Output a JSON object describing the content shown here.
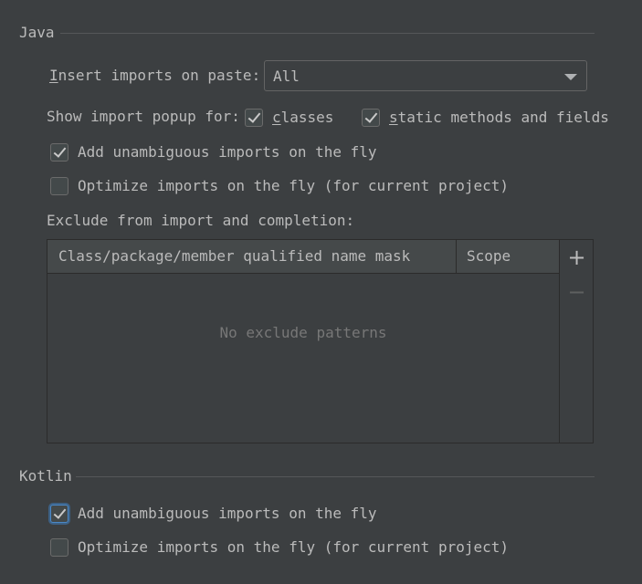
{
  "java": {
    "title": "Java",
    "insert_imports_label": "Insert imports on paste:",
    "insert_imports_mnemonic": "I",
    "insert_imports_rest": "nsert imports on paste:",
    "insert_imports_value": "All",
    "show_popup_label": "Show import popup for:",
    "classes": {
      "mnemonic": "c",
      "rest": "lasses",
      "checked": true
    },
    "static_methods": {
      "mnemonic": "s",
      "rest": "tatic methods and fields",
      "checked": true
    },
    "add_unambiguous": {
      "label": "Add unambiguous imports on the fly",
      "checked": true
    },
    "optimize_imports": {
      "label": "Optimize imports on the fly (for current project)",
      "checked": false
    },
    "exclude_label": "Exclude from import and completion:",
    "table": {
      "columns": [
        "Class/package/member qualified name mask",
        "Scope"
      ],
      "empty_text": "No exclude patterns",
      "add_icon": "plus-icon",
      "remove_icon": "minus-icon",
      "add_glyph": "+",
      "remove_glyph": "−"
    }
  },
  "kotlin": {
    "title": "Kotlin",
    "add_unambiguous": {
      "label": "Add unambiguous imports on the fly",
      "checked": true
    },
    "optimize_imports": {
      "label": "Optimize imports on the fly (for current project)",
      "checked": false
    }
  },
  "colors": {
    "background": "#3c3f41",
    "text": "#bbbbbb",
    "border": "#646464",
    "focus": "#4a88c7",
    "header": "#45494a",
    "muted": "#777777"
  }
}
